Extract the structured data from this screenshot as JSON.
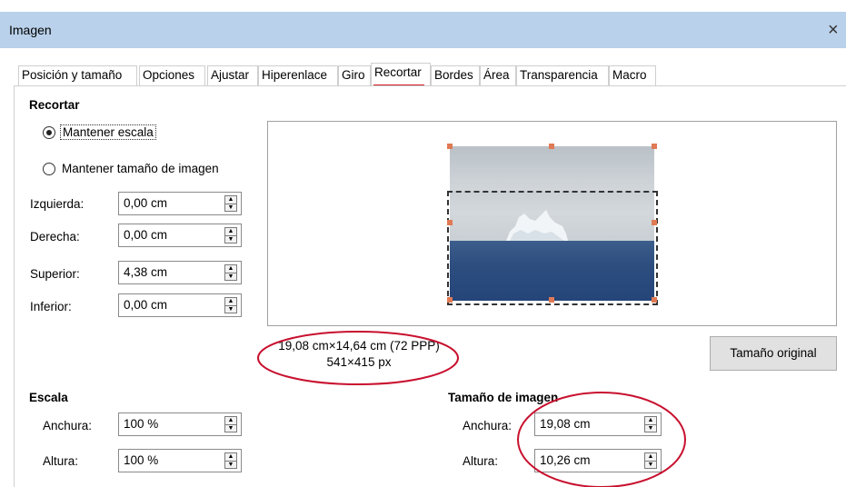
{
  "window": {
    "title": "Imagen",
    "close_glyph": "×"
  },
  "tabs": [
    {
      "label": "Posición y tamaño"
    },
    {
      "label": "Opciones"
    },
    {
      "label": "Ajustar"
    },
    {
      "label": "Hiperenlace"
    },
    {
      "label": "Giro"
    },
    {
      "label": "Recortar",
      "selected": true
    },
    {
      "label": "Bordes"
    },
    {
      "label": "Área"
    },
    {
      "label": "Transparencia"
    },
    {
      "label": "Macro"
    }
  ],
  "crop": {
    "title": "Recortar",
    "keep_scale": {
      "label": "Mantener escala",
      "checked": true
    },
    "keep_size": {
      "label": "Mantener tamaño de imagen",
      "checked": false
    },
    "left": {
      "label": "Izquierda:",
      "value": "0,00 cm"
    },
    "right": {
      "label": "Derecha:",
      "value": "0,00 cm"
    },
    "top": {
      "label": "Superior:",
      "value": "4,38 cm"
    },
    "bottom": {
      "label": "Inferior:",
      "value": "0,00 cm"
    }
  },
  "info": {
    "size_line": "19,08 cm×14,64 cm (72 PPP)",
    "pixels_line": "541×415 px",
    "original_size_button": "Tamaño original"
  },
  "scale": {
    "title": "Escala",
    "width": {
      "label": "Anchura:",
      "value": "100 %"
    },
    "height": {
      "label": "Altura:",
      "value": "100 %"
    }
  },
  "image_size": {
    "title": "Tamaño de imagen",
    "width": {
      "label": "Anchura:",
      "value": "19,08 cm"
    },
    "height": {
      "label": "Altura:",
      "value": "10,26 cm"
    }
  },
  "icons": {
    "spin_up": "▲",
    "spin_down": "▼",
    "close": "close-icon"
  },
  "colors": {
    "titlebar": "#b9d1ea",
    "selected_tab_underline": "#d01f26",
    "annotation_ellipse": "#c8102e",
    "crop_handle": "#e07a55"
  }
}
